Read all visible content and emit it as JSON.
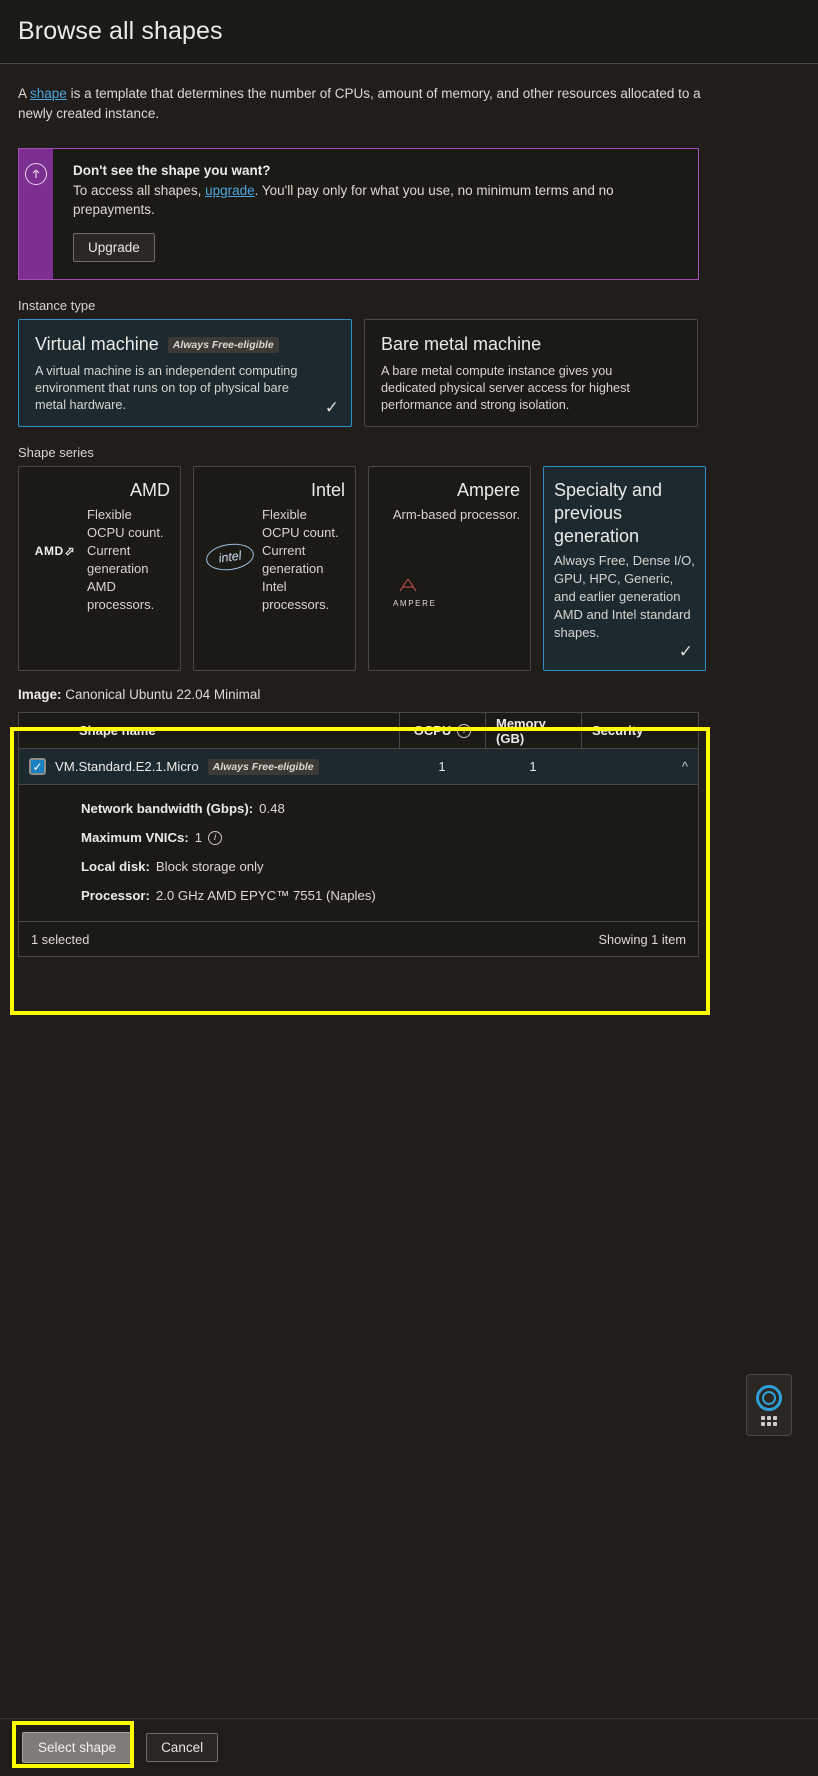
{
  "header": {
    "title": "Browse all shapes"
  },
  "intro": {
    "prefix": "A ",
    "link": "shape",
    "rest": " is a template that determines the number of CPUs, amount of memory, and other resources allocated to a newly created instance."
  },
  "banner": {
    "icon": "upgrade-arrow-icon",
    "title": "Don't see the shape you want?",
    "text_before": "To access all shapes, ",
    "link": "upgrade",
    "text_after": ". You'll pay only for what you use, no minimum terms and no prepayments.",
    "button": "Upgrade",
    "stripe_color": "#7d2f91",
    "border_color": "#a34bb8"
  },
  "instance_type": {
    "label": "Instance type",
    "cards": [
      {
        "title": "Virtual machine",
        "pill": "Always Free-eligible",
        "desc": "A virtual machine is an independent computing environment that runs on top of physical bare metal hardware.",
        "selected": true
      },
      {
        "title": "Bare metal machine",
        "pill": "",
        "desc": "A bare metal compute instance gives you dedicated physical server access for highest performance and strong isolation.",
        "selected": false
      }
    ]
  },
  "shape_series": {
    "label": "Shape series",
    "cards": [
      {
        "title": "AMD",
        "logo": "amd-logo",
        "desc": "Flexible OCPU count. Current generation AMD processors.",
        "selected": false
      },
      {
        "title": "Intel",
        "logo": "intel-logo",
        "desc": "Flexible OCPU count. Current generation Intel processors.",
        "selected": false
      },
      {
        "title": "Ampere",
        "logo": "ampere-logo",
        "desc": "Arm-based processor.",
        "selected": false
      },
      {
        "title": "Specialty and previous generation",
        "logo": "",
        "desc": "Always Free, Dense I/O, GPU, HPC, Generic, and earlier generation AMD and Intel standard shapes.",
        "selected": true
      }
    ]
  },
  "image": {
    "label": "Image:",
    "value": "Canonical Ubuntu 22.04 Minimal"
  },
  "table": {
    "columns": [
      "Shape name",
      "OCPU",
      "Memory (GB)",
      "Security"
    ],
    "row": {
      "name": "VM.Standard.E2.1.Micro",
      "pill": "Always Free-eligible",
      "ocpu": "1",
      "memory": "1",
      "security": "",
      "checked": true,
      "expanded": true
    },
    "details": [
      {
        "label": "Network bandwidth (Gbps):",
        "value": "0.48",
        "info": false
      },
      {
        "label": "Maximum VNICs:",
        "value": "1",
        "info": true
      },
      {
        "label": "Local disk:",
        "value": "Block storage only",
        "info": false
      },
      {
        "label": "Processor:",
        "value": "2.0 GHz AMD EPYC™ 7551 (Naples)",
        "info": false
      }
    ],
    "footer_left": "1 selected",
    "footer_right": "Showing 1 item"
  },
  "help_widget": {
    "ring": "life-ring-icon",
    "dots": "apps-grid-icon"
  },
  "footer": {
    "select": "Select shape",
    "cancel": "Cancel"
  },
  "highlight_color": "#ffff00"
}
